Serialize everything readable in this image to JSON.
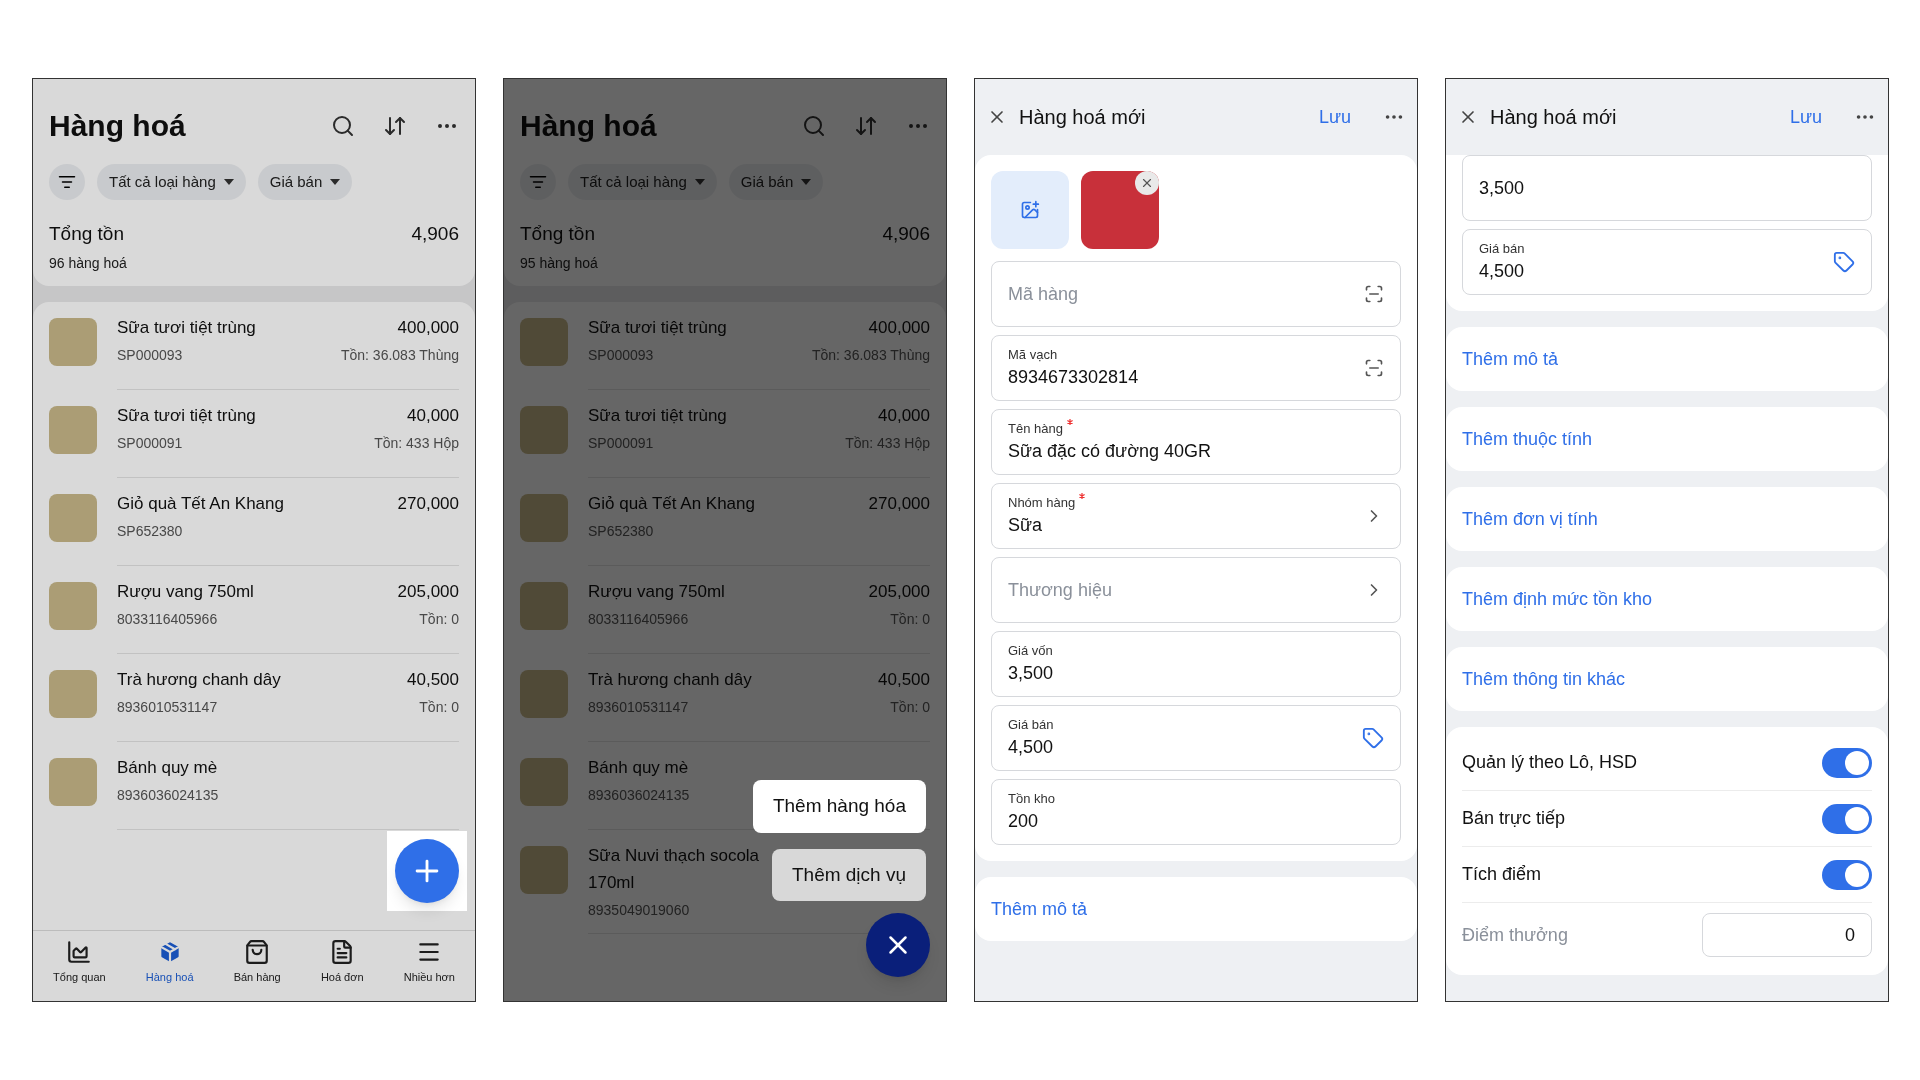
{
  "screens": [
    {
      "kind": "list",
      "title": "Hàng hoá",
      "filters": [
        "Tất cả loại hàng",
        "Giá bán"
      ],
      "total_label": "Tổng tồn",
      "total_value": "4,906",
      "count": "96 hàng hoá",
      "items": [
        {
          "name": "Sữa tươi tiệt trùng",
          "code": "SP000093",
          "price": "400,000",
          "stock": "Tồn: 36.083 Thùng"
        },
        {
          "name": "Sữa tươi tiệt trùng",
          "code": "SP000091",
          "price": "40,000",
          "stock": "Tồn: 433 Hộp"
        },
        {
          "name": "Giỏ quà Tết An Khang",
          "code": "SP652380",
          "price": "270,000"
        },
        {
          "name": "Rượu vang 750ml",
          "code": "8033116405966",
          "price": "205,000",
          "stock": "Tồn: 0"
        },
        {
          "name": "Trà hương chanh dây",
          "code": "8936010531147",
          "price": "40,500",
          "stock": "Tồn: 0"
        },
        {
          "name": "Bánh quy mè",
          "code": "8936036024135"
        }
      ],
      "fab": {
        "open": false,
        "highlighted": true
      },
      "nav": [
        {
          "label": "Tổng quan",
          "selected": false
        },
        {
          "label": "Hàng hoá",
          "selected": true
        },
        {
          "label": "Bán hàng",
          "selected": false
        },
        {
          "label": "Hoá đơn",
          "selected": false
        },
        {
          "label": "Nhiều hơn",
          "selected": false
        }
      ]
    },
    {
      "kind": "list",
      "title": "Hàng hoá",
      "filters": [
        "Tất cả loại hàng",
        "Giá bán"
      ],
      "total_label": "Tổng tồn",
      "total_value": "4,906",
      "count": "95 hàng hoá",
      "items": [
        {
          "name": "Sữa tươi tiệt trùng",
          "code": "SP000093",
          "price": "400,000",
          "stock": "Tồn: 36.083 Thùng"
        },
        {
          "name": "Sữa tươi tiệt trùng",
          "code": "SP000091",
          "price": "40,000",
          "stock": "Tồn: 433 Hộp"
        },
        {
          "name": "Giỏ quà Tết An Khang",
          "code": "SP652380",
          "price": "270,000"
        },
        {
          "name": "Rượu vang 750ml",
          "code": "8033116405966",
          "price": "205,000",
          "stock": "Tồn: 0"
        },
        {
          "name": "Trà hương chanh dây",
          "code": "8936010531147",
          "price": "40,500",
          "stock": "Tồn: 0"
        },
        {
          "name": "Bánh quy mè",
          "code": "8936036024135"
        },
        {
          "name": "Sữa Nuvi thạch socola 170ml",
          "code": "8935049019060"
        }
      ],
      "menu": [
        "Thêm hàng hóa",
        "Thêm dịch vụ"
      ],
      "fab": {
        "open": true
      }
    },
    {
      "kind": "form",
      "title": "Hàng hoá mới",
      "save": "Lưu",
      "photos": true,
      "fields": [
        {
          "kind": "scan",
          "placeholder": "Mã hàng"
        },
        {
          "kind": "scan",
          "label": "Mã vạch",
          "value": "8934673302814"
        },
        {
          "kind": "text",
          "label": "Tên hàng",
          "required": true,
          "value": "Sữa đặc có đường 40GR"
        },
        {
          "kind": "select",
          "label": "Nhóm hàng",
          "required": true,
          "value": "Sữa"
        },
        {
          "kind": "select",
          "placeholder": "Thương hiệu"
        },
        {
          "kind": "text",
          "label": "Giá vốn",
          "value": "3,500"
        },
        {
          "kind": "price",
          "label": "Giá bán",
          "value": "4,500"
        },
        {
          "kind": "text",
          "label": "Tồn kho",
          "value": "200"
        }
      ],
      "links": [
        "Thêm mô tả"
      ]
    },
    {
      "kind": "form",
      "title": "Hàng hoá mới",
      "save": "Lưu",
      "photos": false,
      "fields": [
        {
          "kind": "text",
          "value": "3,500"
        },
        {
          "kind": "price",
          "label": "Giá bán",
          "value": "4,500"
        }
      ],
      "links": [
        "Thêm mô tả",
        "Thêm thuộc tính",
        "Thêm đơn vị tính",
        "Thêm định mức tồn kho",
        "Thêm thông tin khác"
      ],
      "toggles": [
        {
          "label": "Quản lý theo Lô, HSD",
          "on": true
        },
        {
          "label": "Bán trực tiếp",
          "on": true
        },
        {
          "label": "Tích điểm",
          "on": true
        }
      ],
      "points": {
        "label": "Điểm thưởng",
        "value": "0"
      }
    }
  ]
}
